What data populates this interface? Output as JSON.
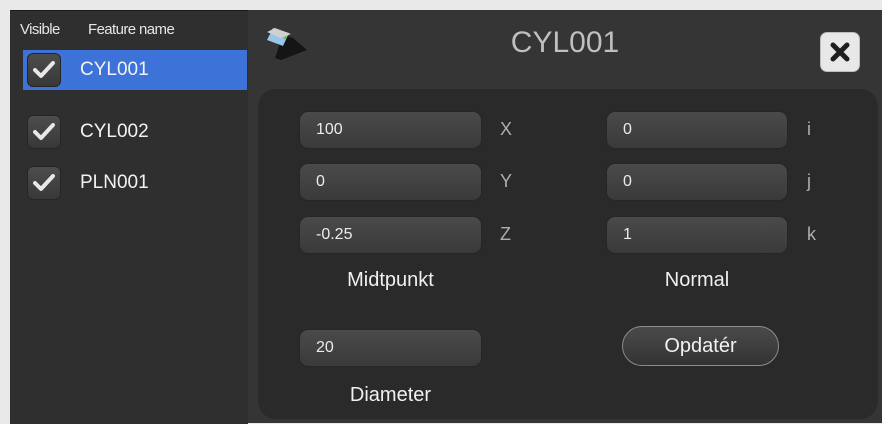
{
  "sidebar": {
    "header": {
      "visible_label": "Visible",
      "name_label": "Feature name"
    },
    "features": [
      {
        "name": "CYL001",
        "visible": true,
        "selected": true
      },
      {
        "name": "CYL002",
        "visible": true,
        "selected": false
      },
      {
        "name": "PLN001",
        "visible": true,
        "selected": false
      }
    ]
  },
  "detail": {
    "title": "CYL001",
    "title_icon": "cylinder-feature-icon",
    "close_icon": "close-icon",
    "midpoint": {
      "x": "100",
      "y": "0",
      "z": "-0.25",
      "x_label": "X",
      "y_label": "Y",
      "z_label": "Z",
      "caption": "Midtpunkt"
    },
    "normal": {
      "i": "0",
      "j": "0",
      "k": "1",
      "i_label": "i",
      "j_label": "j",
      "k_label": "k",
      "caption": "Normal"
    },
    "diameter": {
      "value": "20",
      "caption": "Diameter"
    },
    "update_label": "Opdatér"
  },
  "colors": {
    "selection": "#3d73d9",
    "panel_bg": "#2a2a2a",
    "window_bg": "#353535"
  }
}
